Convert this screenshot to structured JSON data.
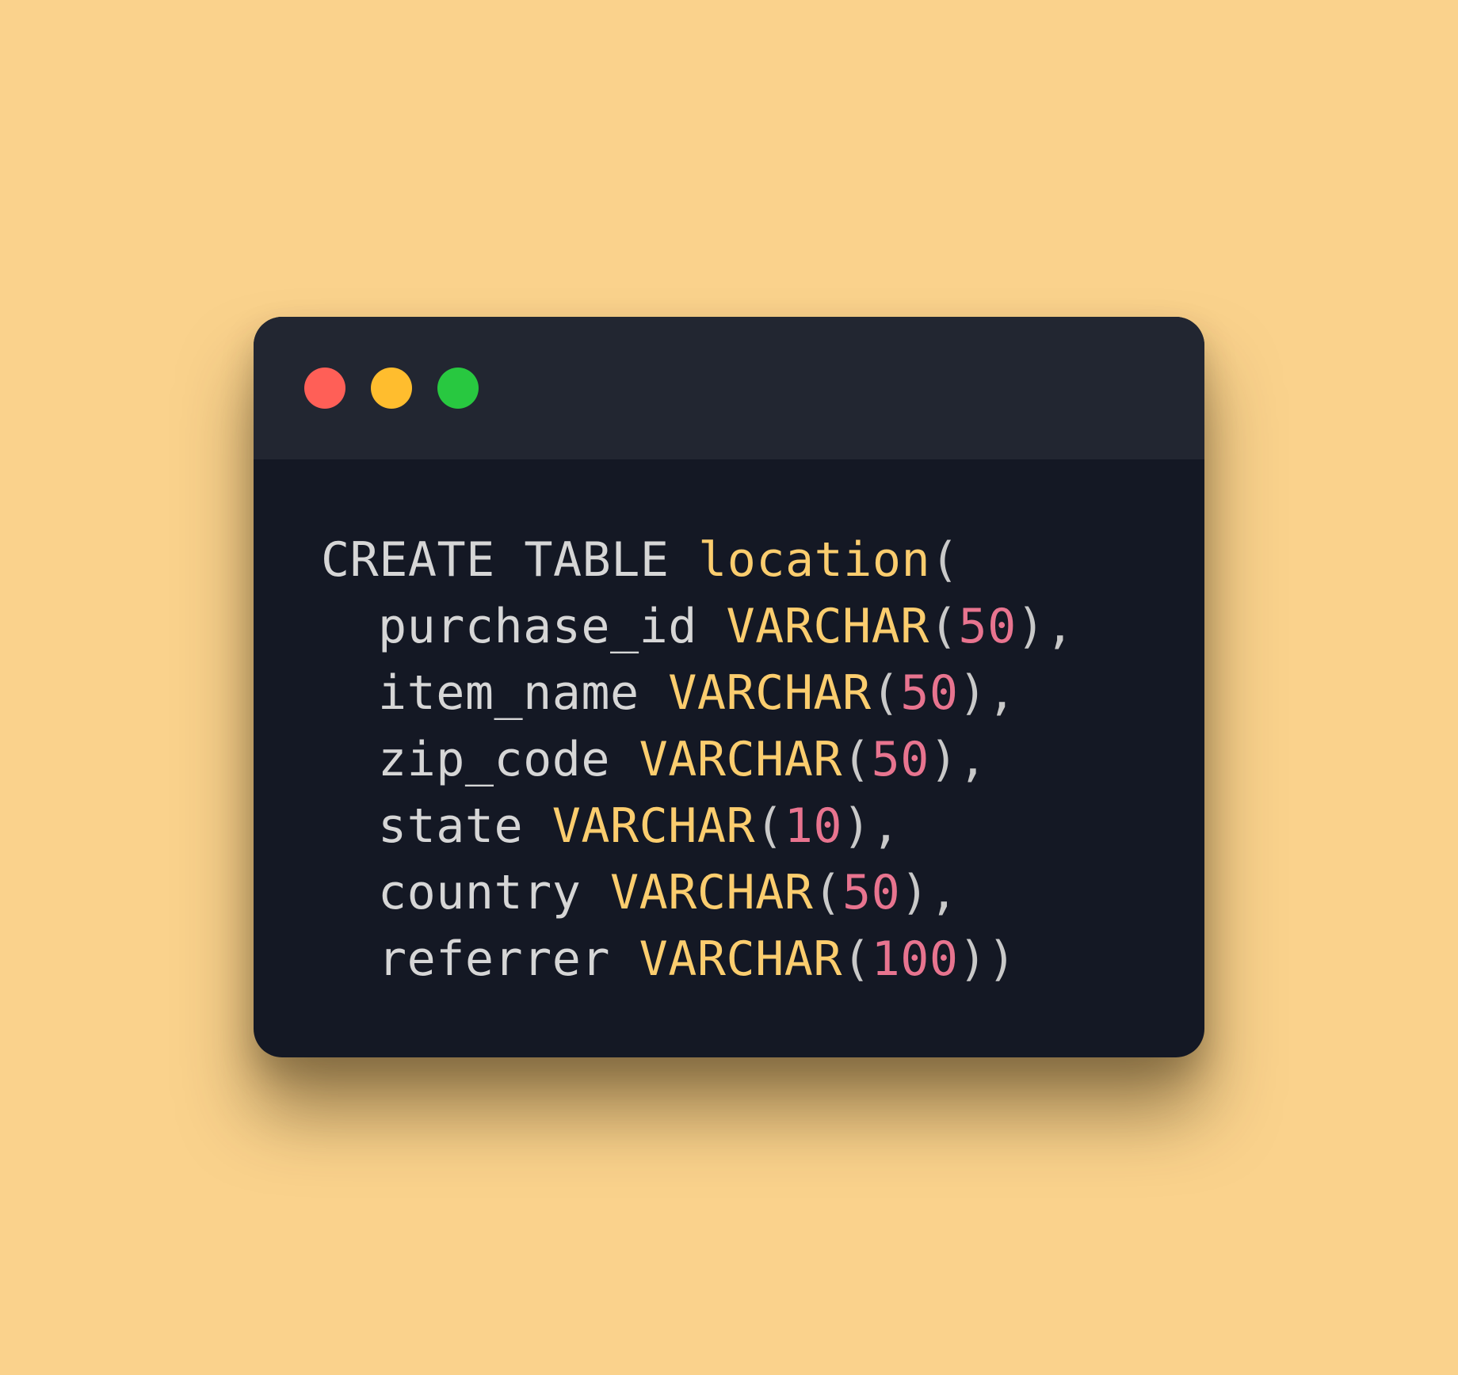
{
  "window": {
    "buttons": {
      "close": {
        "name": "close",
        "color": "#FF5F57"
      },
      "minimize": {
        "name": "minimize",
        "color": "#FFBD2E"
      },
      "maximize": {
        "name": "maximize",
        "color": "#28C840"
      }
    }
  },
  "colors": {
    "background": "#FAD28C",
    "window_body": "#141824",
    "title_bar": "#222631",
    "plain_text": "#D6D6D6",
    "identifier": "#FBCD6E",
    "type": "#FBCD6E",
    "number": "#E8748F",
    "punctuation": "#C9C9C9"
  },
  "code": {
    "language": "SQL",
    "lines": [
      {
        "tokens": [
          {
            "kind": "plain",
            "text": "CREATE TABLE "
          },
          {
            "kind": "ident",
            "text": "location"
          },
          {
            "kind": "punct",
            "text": "("
          }
        ]
      },
      {
        "tokens": [
          {
            "kind": "plain",
            "text": "purchase_id "
          },
          {
            "kind": "type",
            "text": "VARCHAR"
          },
          {
            "kind": "punct",
            "text": "("
          },
          {
            "kind": "num",
            "text": "50"
          },
          {
            "kind": "punct",
            "text": "),"
          }
        ]
      },
      {
        "tokens": [
          {
            "kind": "plain",
            "text": "item_name "
          },
          {
            "kind": "type",
            "text": "VARCHAR"
          },
          {
            "kind": "punct",
            "text": "("
          },
          {
            "kind": "num",
            "text": "50"
          },
          {
            "kind": "punct",
            "text": "),"
          }
        ]
      },
      {
        "tokens": [
          {
            "kind": "plain",
            "text": "zip_code "
          },
          {
            "kind": "type",
            "text": "VARCHAR"
          },
          {
            "kind": "punct",
            "text": "("
          },
          {
            "kind": "num",
            "text": "50"
          },
          {
            "kind": "punct",
            "text": "),"
          }
        ]
      },
      {
        "tokens": [
          {
            "kind": "plain",
            "text": "state "
          },
          {
            "kind": "type",
            "text": "VARCHAR"
          },
          {
            "kind": "punct",
            "text": "("
          },
          {
            "kind": "num",
            "text": "10"
          },
          {
            "kind": "punct",
            "text": "),"
          }
        ]
      },
      {
        "tokens": [
          {
            "kind": "plain",
            "text": "country "
          },
          {
            "kind": "type",
            "text": "VARCHAR"
          },
          {
            "kind": "punct",
            "text": "("
          },
          {
            "kind": "num",
            "text": "50"
          },
          {
            "kind": "punct",
            "text": "),"
          }
        ]
      },
      {
        "tokens": [
          {
            "kind": "plain",
            "text": "referrer "
          },
          {
            "kind": "type",
            "text": "VARCHAR"
          },
          {
            "kind": "punct",
            "text": "("
          },
          {
            "kind": "num",
            "text": "100"
          },
          {
            "kind": "punct",
            "text": "))"
          }
        ]
      }
    ]
  }
}
